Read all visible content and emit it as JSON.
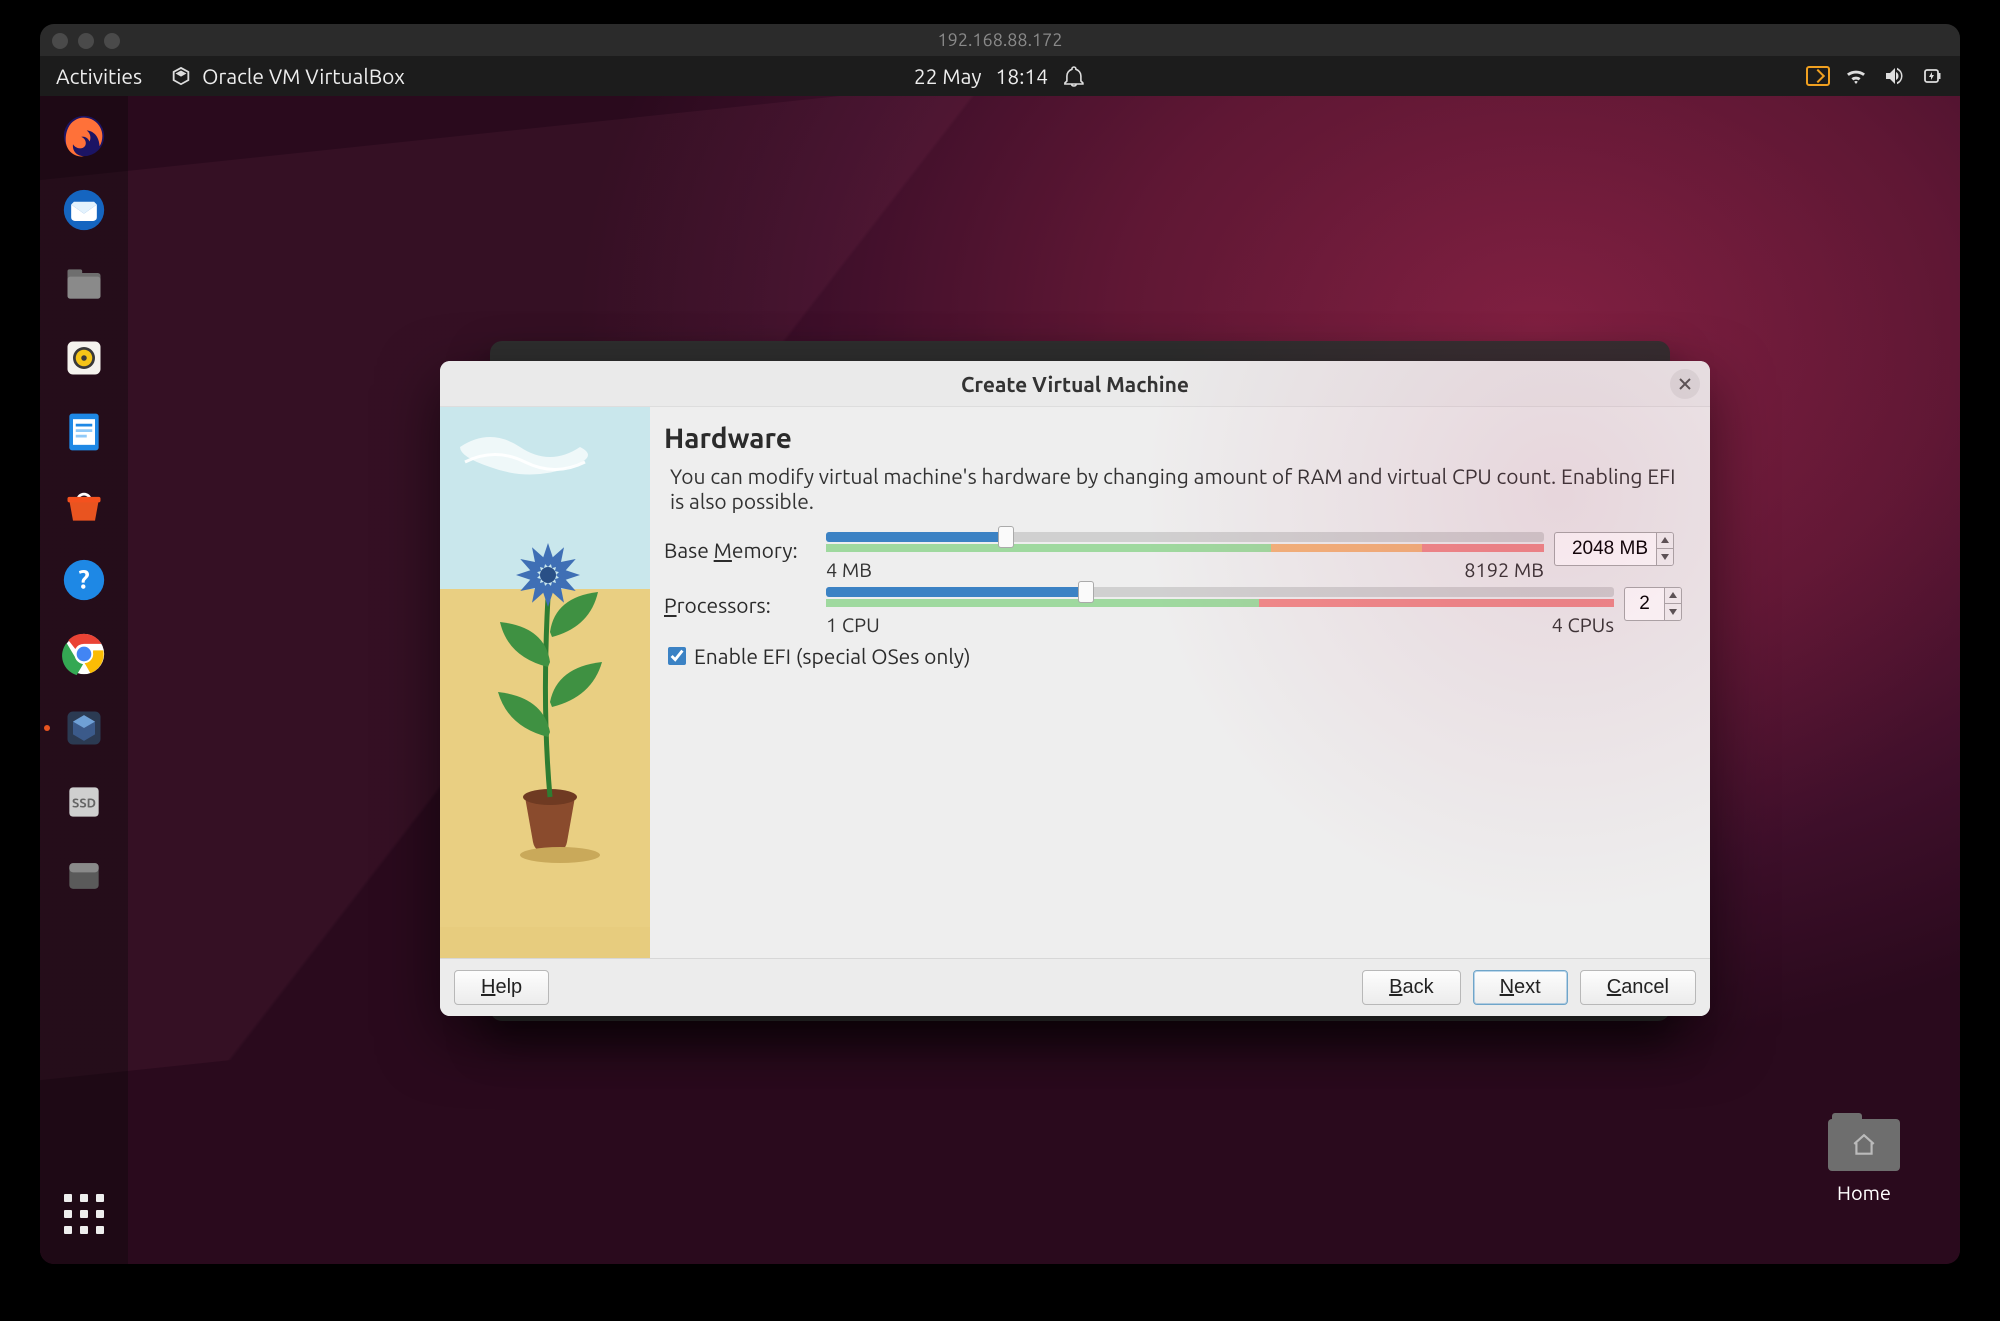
{
  "remote": {
    "host": "192.168.88.172"
  },
  "topbar": {
    "activities": "Activities",
    "app_name": "Oracle VM VirtualBox",
    "date": "22 May",
    "time": "18:14"
  },
  "desktop": {
    "home_label": "Home"
  },
  "dock": {
    "items": [
      {
        "name": "firefox"
      },
      {
        "name": "thunderbird"
      },
      {
        "name": "files"
      },
      {
        "name": "rhythmbox"
      },
      {
        "name": "libreoffice-writer"
      },
      {
        "name": "ubuntu-software"
      },
      {
        "name": "help"
      },
      {
        "name": "google-chrome"
      },
      {
        "name": "virtualbox",
        "running": true
      },
      {
        "name": "disk-ssd"
      },
      {
        "name": "unknown-app"
      }
    ]
  },
  "dialog": {
    "title": "Create Virtual Machine",
    "heading": "Hardware",
    "description": "You can modify virtual machine's hardware by changing amount of RAM and virtual CPU count. Enabling EFI is also possible.",
    "memory": {
      "label_pre": "Base ",
      "label_ul": "M",
      "label_post": "emory:",
      "min_label": "4 MB",
      "max_label": "8192 MB",
      "value_text": "2048 MB",
      "value_mb": 2048,
      "min_mb": 4,
      "max_mb": 8192,
      "fill_pct": 25,
      "green_end_pct": 62,
      "orange_end_pct": 83
    },
    "cpu": {
      "label_ul": "P",
      "label_post": "rocessors:",
      "min_label": "1 CPU",
      "max_label": "4 CPUs",
      "value_text": "2",
      "value": 2,
      "min": 1,
      "max": 4,
      "fill_pct": 33,
      "green_end_pct": 55
    },
    "efi": {
      "checked": true,
      "label_ul": "E",
      "label_post": "nable EFI (special OSes only)"
    },
    "buttons": {
      "help_ul": "H",
      "help_post": "elp",
      "back_ul": "B",
      "back_post": "ack",
      "next_ul": "N",
      "next_post": "ext",
      "cancel_ul": "C",
      "cancel_post": "ancel"
    }
  }
}
